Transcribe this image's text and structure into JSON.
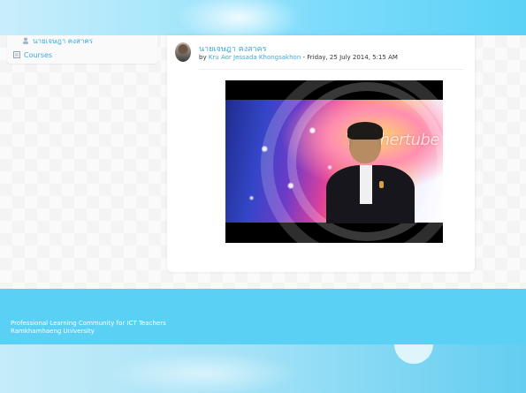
{
  "sidebar": {
    "items": [
      {
        "label": "นายเจษฎา คงสาคร",
        "icon": "user-icon"
      },
      {
        "label": "Courses",
        "icon": "courses-icon"
      }
    ]
  },
  "post": {
    "title": "นายเจษฎา คงสาคร",
    "by_prefix": "by",
    "author": "Kru Aor Jessada Khongsakhon",
    "date_separator": "-",
    "date": "Friday, 25 July 2014, 5:15 AM"
  },
  "video": {
    "logo_text": "Teachertube"
  },
  "footer": {
    "line1": "Professional Learning Community for ICT Teachers",
    "line2": "Ramkhamhaeng University"
  },
  "colors": {
    "accent": "#3ca9d6",
    "footer_band": "#5ad0f5"
  }
}
